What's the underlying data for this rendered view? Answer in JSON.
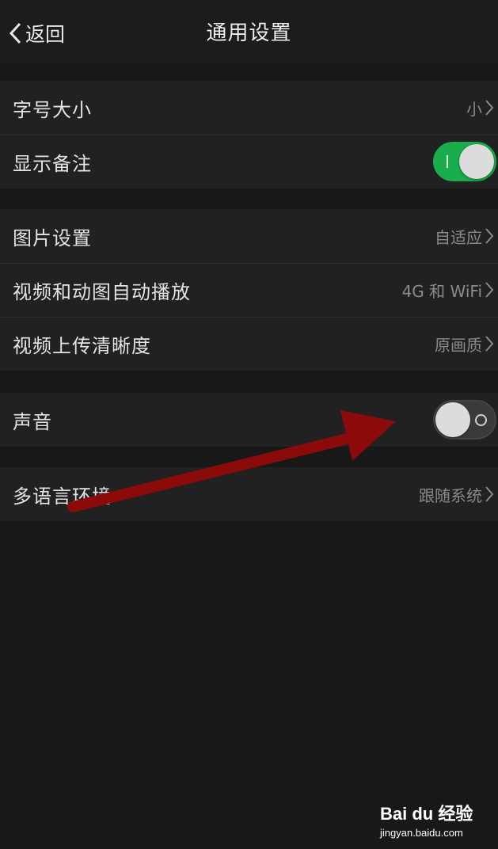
{
  "nav": {
    "back_label": "返回",
    "title": "通用设置"
  },
  "group1": [
    {
      "label": "字号大小",
      "value": "小"
    },
    {
      "label": "显示备注",
      "toggle": "on"
    }
  ],
  "group2": [
    {
      "label": "图片设置",
      "value": "自适应"
    },
    {
      "label": "视频和动图自动播放",
      "value": "4G 和 WiFi"
    },
    {
      "label": "视频上传清晰度",
      "value": "原画质"
    }
  ],
  "group3": [
    {
      "label": "声音",
      "toggle": "off"
    }
  ],
  "group4": [
    {
      "label": "多语言环境",
      "value": "跟随系统"
    }
  ],
  "colors": {
    "background": "#181818",
    "toggle_on": "#1aad4b",
    "arrow": "#8b0a0a"
  },
  "watermark": {
    "brand": "Bai du 经验",
    "sub": "jingyan.baidu.com"
  }
}
